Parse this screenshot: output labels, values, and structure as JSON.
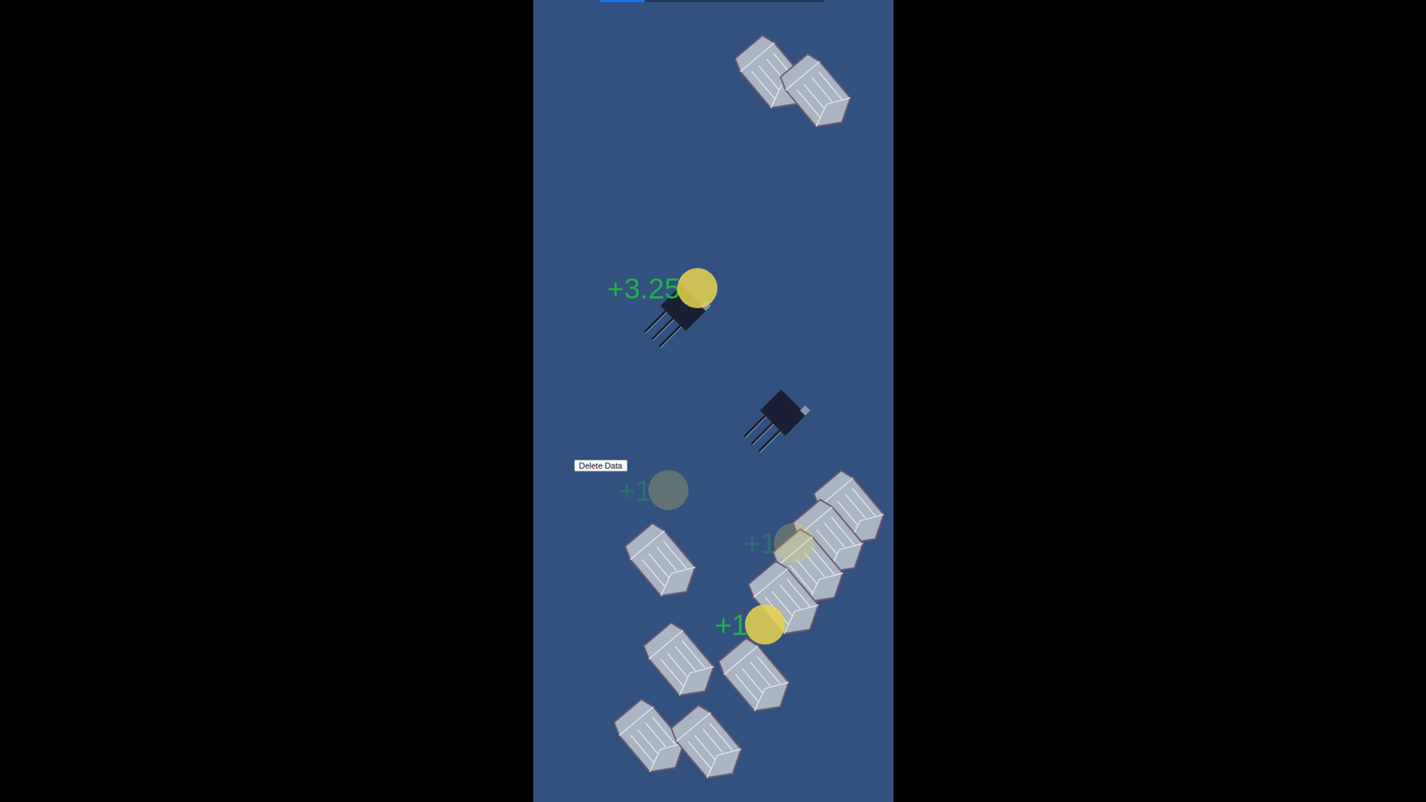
{
  "game": {
    "progress": {
      "level": 0.2
    },
    "delete_button": {
      "label": "Delete Data"
    },
    "popups": [
      {
        "text": "+3.25",
        "faded": false
      },
      {
        "text": "+1",
        "faded": true
      },
      {
        "text": "+1",
        "faded": true
      },
      {
        "text": "+1",
        "faded": false
      }
    ]
  }
}
